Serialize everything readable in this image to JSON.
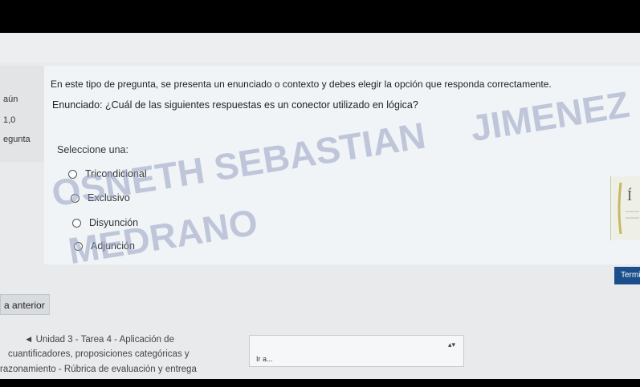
{
  "sidebar": {
    "status": "aún",
    "marks": "1,0",
    "question_label": "egunta"
  },
  "question": {
    "intro": "En este tipo de pregunta, se presenta un enunciado o contexto y debes elegir la opción que responda correctamente.",
    "text": "Enunciado: ¿Cuál de las siguientes respuestas es un conector utilizado en lógica?",
    "prompt": "Seleccione una:",
    "options": [
      "Tricondicional",
      "Exclusivo",
      "Disyunción",
      "Adjunción"
    ]
  },
  "watermark": {
    "line1": "JIMENEZ",
    "line2": "OSNETH SEBASTIAN",
    "line3": "MEDRANO"
  },
  "buttons": {
    "finish": "Termi",
    "previous": "a anterior"
  },
  "footer": {
    "prev_activity_line1": "◄ Unidad 3 - Tarea 4 - Aplicación de",
    "prev_activity_line2": "cuantificadores, proposiciones categóricas y",
    "prev_activity_line3": "razonamiento - Rúbrica de evaluación y entrega",
    "jump_value": "Ir a..."
  }
}
